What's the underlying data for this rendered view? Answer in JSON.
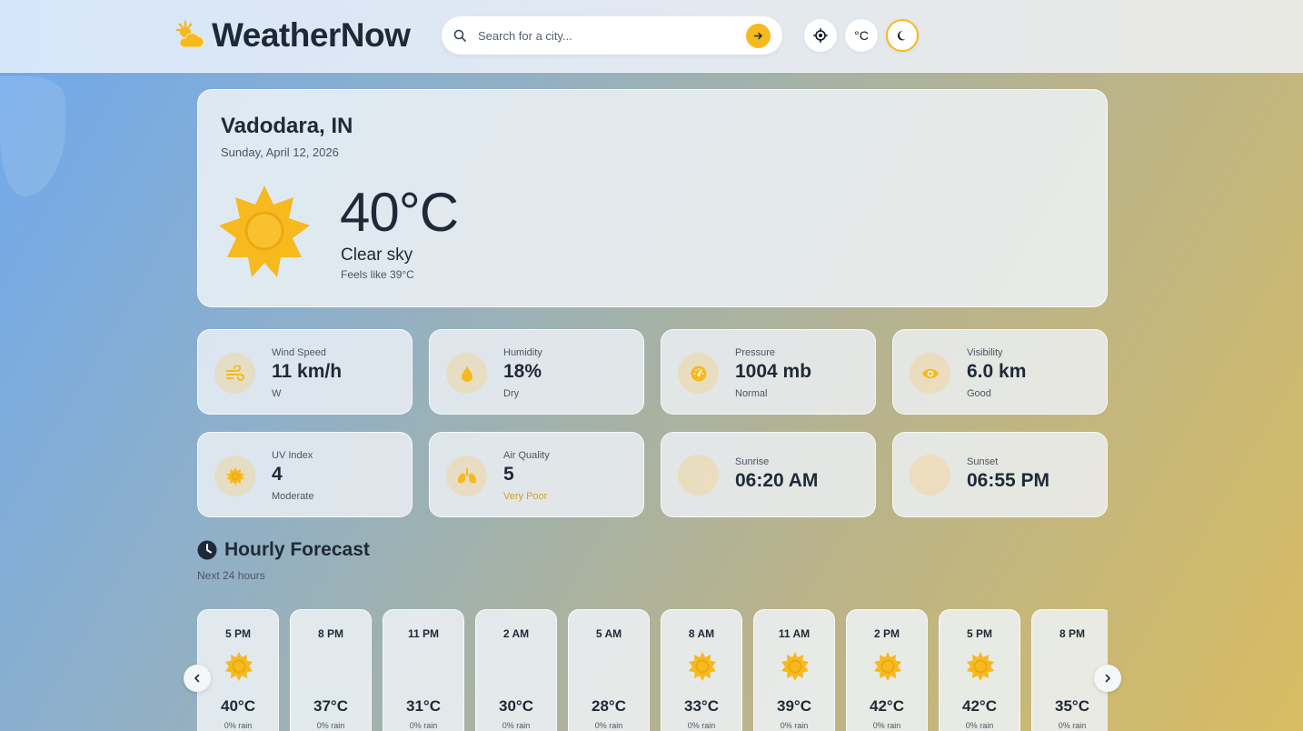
{
  "app": {
    "name": "WeatherNow"
  },
  "search": {
    "placeholder": "Search for a city..."
  },
  "header": {
    "unit_label": "°C"
  },
  "current": {
    "city": "Vadodara, IN",
    "date": "Sunday, April 12, 2026",
    "temperature": "40°C",
    "condition": "Clear sky",
    "feels_like": "Feels like 39°C"
  },
  "stats": [
    {
      "label": "Wind Speed",
      "value": "11 km/h",
      "sub": "W",
      "icon": "wind-icon"
    },
    {
      "label": "Humidity",
      "value": "18%",
      "sub": "Dry",
      "icon": "droplet-icon"
    },
    {
      "label": "Pressure",
      "value": "1004 mb",
      "sub": "Normal",
      "icon": "gauge-icon"
    },
    {
      "label": "Visibility",
      "value": "6.0 km",
      "sub": "Good",
      "icon": "eye-icon"
    },
    {
      "label": "UV Index",
      "value": "4",
      "sub": "Moderate",
      "icon": "sun-icon"
    },
    {
      "label": "Air Quality",
      "value": "5",
      "sub": "Very Poor",
      "icon": "lungs-icon"
    },
    {
      "label": "Sunrise",
      "value": "06:20 AM",
      "icon": "sunrise-icon"
    },
    {
      "label": "Sunset",
      "value": "06:55 PM",
      "icon": "sunset-icon"
    }
  ],
  "hourly": {
    "title": "Hourly Forecast",
    "subtitle": "Next 24 hours",
    "items": [
      {
        "time": "5 PM",
        "icon": "sun",
        "temp": "40°C",
        "rain": "0% rain"
      },
      {
        "time": "8 PM",
        "icon": "moon",
        "temp": "37°C",
        "rain": "0% rain"
      },
      {
        "time": "11 PM",
        "icon": "moon",
        "temp": "31°C",
        "rain": "0% rain"
      },
      {
        "time": "2 AM",
        "icon": "moon",
        "temp": "30°C",
        "rain": "0% rain"
      },
      {
        "time": "5 AM",
        "icon": "moon",
        "temp": "28°C",
        "rain": "0% rain"
      },
      {
        "time": "8 AM",
        "icon": "sun",
        "temp": "33°C",
        "rain": "0% rain"
      },
      {
        "time": "11 AM",
        "icon": "sun",
        "temp": "39°C",
        "rain": "0% rain"
      },
      {
        "time": "2 PM",
        "icon": "sun",
        "temp": "42°C",
        "rain": "0% rain"
      },
      {
        "time": "5 PM",
        "icon": "sun",
        "temp": "42°C",
        "rain": "0% rain"
      },
      {
        "time": "8 PM",
        "icon": "moon",
        "temp": "35°C",
        "rain": "0% rain"
      }
    ]
  },
  "colors": {
    "accent": "#f6b91e",
    "text": "#1f2937",
    "warning": "#d4a21c"
  }
}
